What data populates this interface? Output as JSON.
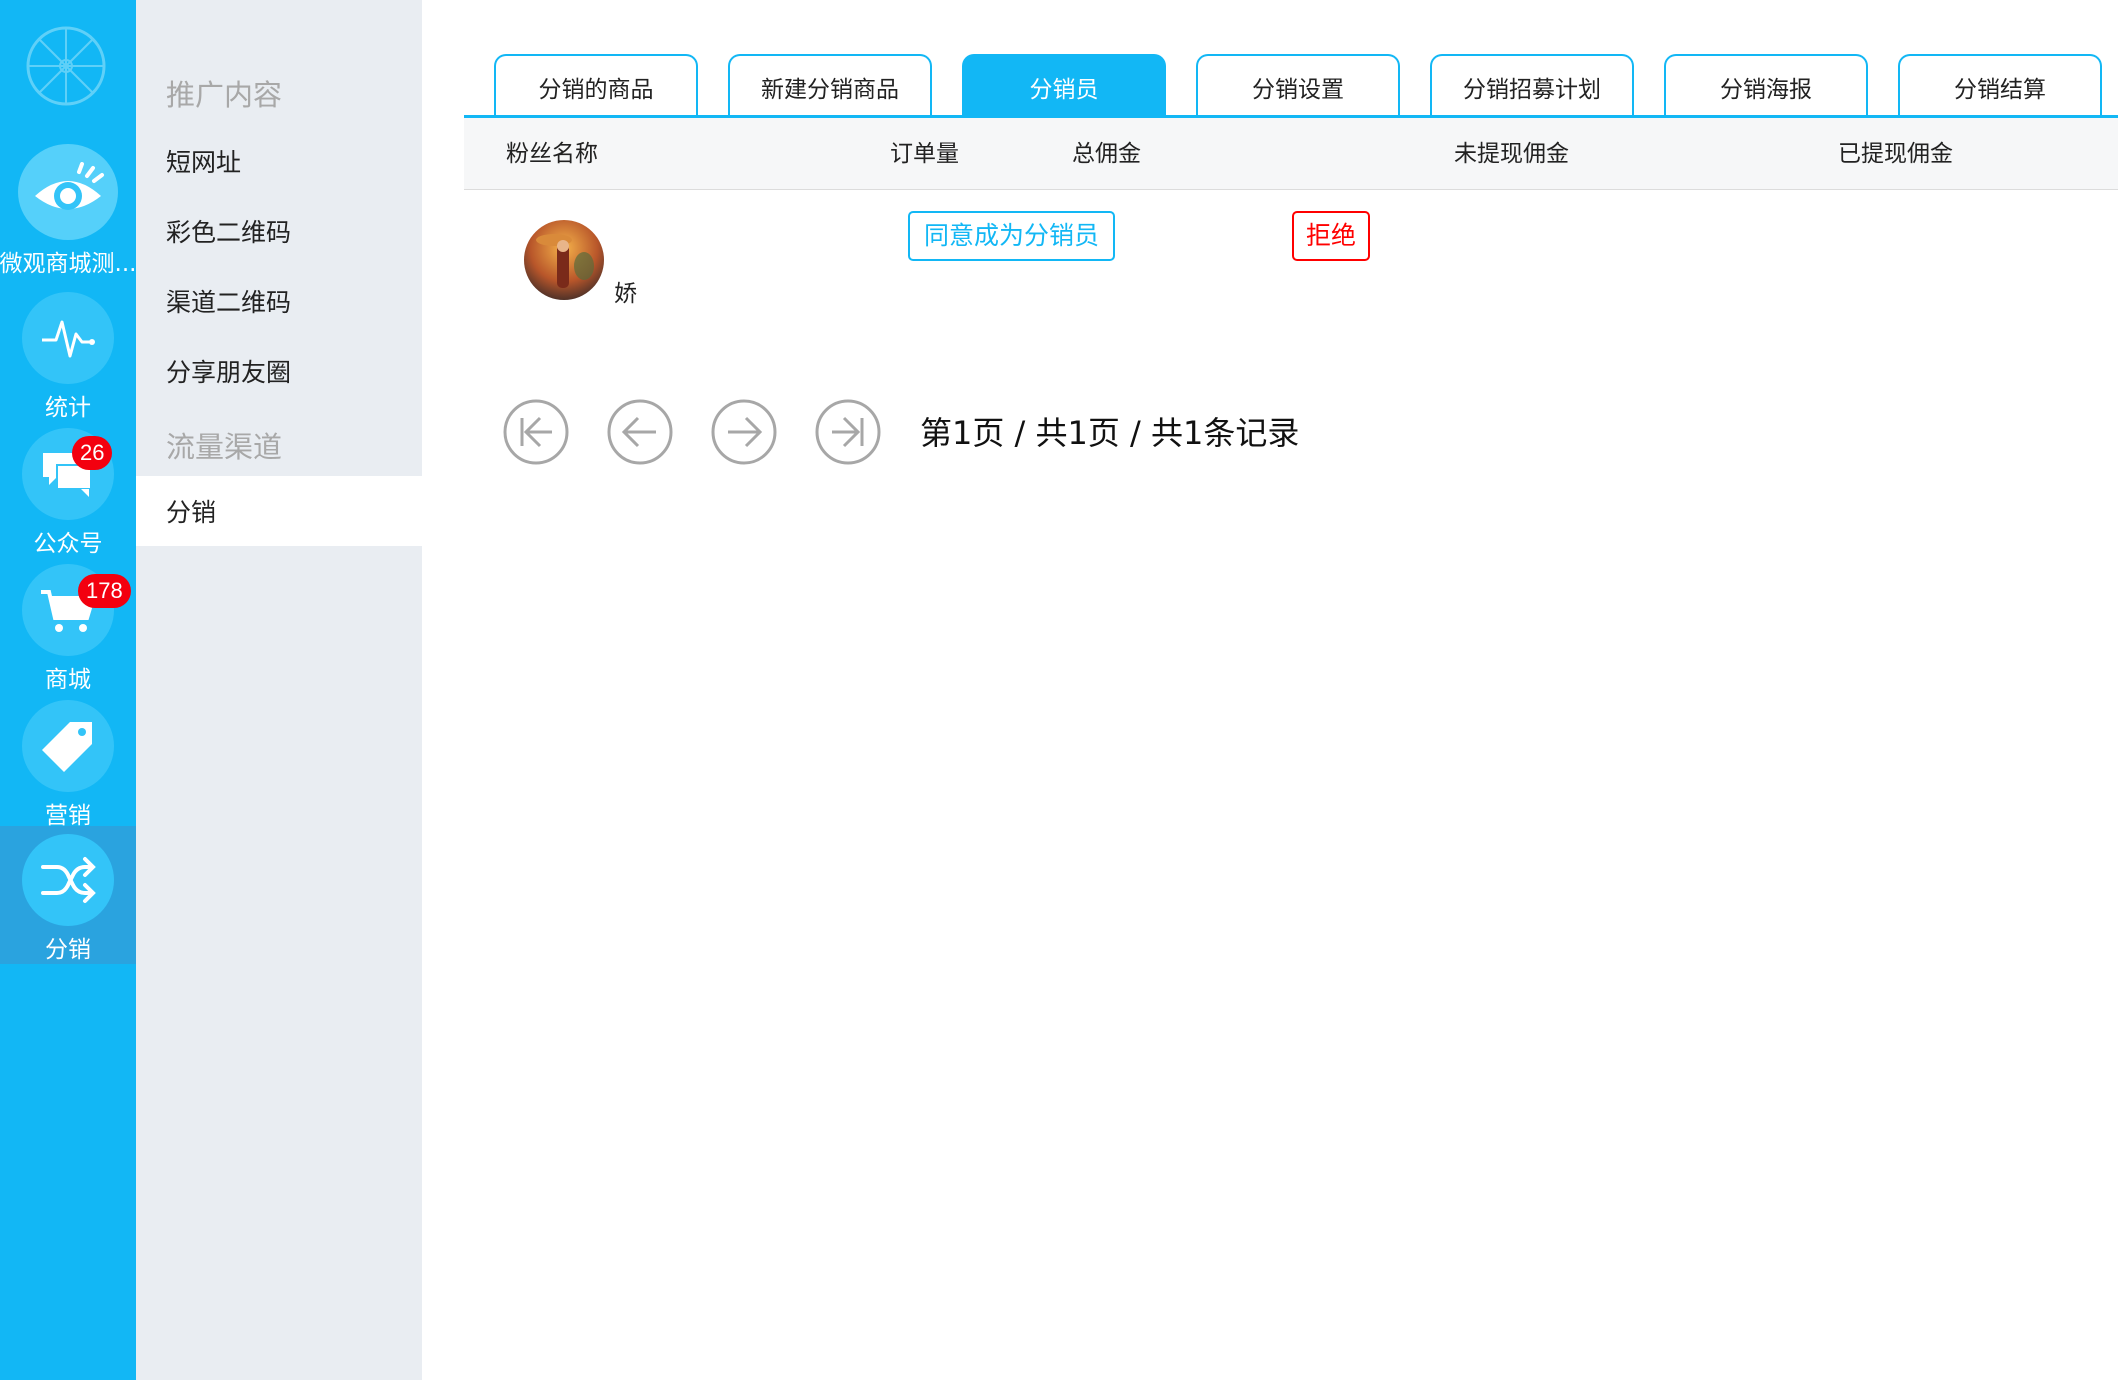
{
  "rail": {
    "items": [
      {
        "label": "微观商城测..."
      },
      {
        "label": "统计"
      },
      {
        "label": "公众号",
        "badge": "26"
      },
      {
        "label": "商城",
        "badge": "178"
      },
      {
        "label": "营销"
      },
      {
        "label": "分销"
      }
    ]
  },
  "subnav": {
    "section1": "推广内容",
    "items1": [
      "短网址",
      "彩色二维码",
      "渠道二维码",
      "分享朋友圈"
    ],
    "section2": "流量渠道",
    "items2": [
      "分销"
    ]
  },
  "tabs": [
    {
      "label": "分销的商品"
    },
    {
      "label": "新建分销商品"
    },
    {
      "label": "分销员"
    },
    {
      "label": "分销设置"
    },
    {
      "label": "分销招募计划"
    },
    {
      "label": "分销海报"
    },
    {
      "label": "分销结算"
    }
  ],
  "table": {
    "headers": [
      "粉丝名称",
      "订单量",
      "总佣金",
      "未提现佣金",
      "已提现佣金"
    ],
    "rows": [
      {
        "name": "娇",
        "agree_label": "同意成为分销员",
        "reject_label": "拒绝"
      }
    ]
  },
  "pagination": {
    "info": "第1页 / 共1页 / 共1条记录"
  },
  "colors": {
    "accent": "#12b7f5",
    "badge": "#f3000f",
    "reject": "#ff0000"
  }
}
